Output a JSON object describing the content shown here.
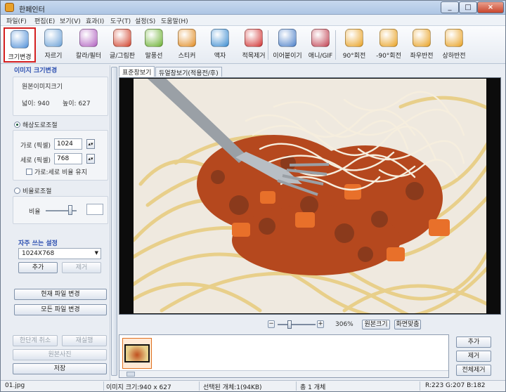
{
  "window": {
    "title": "한페인터",
    "minimize": "_",
    "maximize": "□",
    "close": "×"
  },
  "menu": [
    "파일(F)",
    "편집(E)",
    "보기(V)",
    "효과(I)",
    "도구(T)",
    "설정(S)",
    "도움말(H)"
  ],
  "toolbar": [
    {
      "label": "크기변경",
      "icon": "resize-icon",
      "color": "#4f8fd8"
    },
    {
      "label": "자르기",
      "icon": "crop-icon",
      "color": "#6aa0d6"
    },
    {
      "label": "칼라/필터",
      "icon": "color-filter-icon",
      "color": "#b060c0"
    },
    {
      "label": "글/그림판",
      "icon": "text-paint-icon",
      "color": "#d0402a"
    },
    {
      "label": "말풍선",
      "icon": "speech-bubble-icon",
      "color": "#6ab030"
    },
    {
      "label": "스티커",
      "icon": "sticker-icon",
      "color": "#e08a20"
    },
    {
      "label": "액자",
      "icon": "frame-icon",
      "color": "#3a8bd0"
    },
    {
      "label": "적목제거",
      "icon": "redeye-icon",
      "color": "#d03030"
    },
    {
      "label": "이어붙이기",
      "icon": "merge-icon",
      "color": "#4a7ec8"
    },
    {
      "label": "애니/GIF",
      "icon": "gif-icon",
      "color": "#c04050"
    },
    {
      "label": "90°회전",
      "icon": "rotate-right-icon",
      "color": "#e8a020"
    },
    {
      "label": "-90°회전",
      "icon": "rotate-left-icon",
      "color": "#e8a020"
    },
    {
      "label": "좌우반전",
      "icon": "flip-horizontal-icon",
      "color": "#e8a020"
    },
    {
      "label": "상하반전",
      "icon": "flip-vertical-icon",
      "color": "#e8a020"
    }
  ],
  "left": {
    "section_title": "이미지 크기변경",
    "original_label": "원본이미지크기",
    "width_text": "넓이: 940",
    "height_text": "높이: 627",
    "resolution_label": "해상도로조절",
    "w_label": "가로 (픽셀)",
    "w_value": "1024",
    "h_label": "세로 (픽셀)",
    "h_value": "768",
    "keep_ratio_label": "가로:세로 비율 유지",
    "ratio_label": "비율로조절",
    "ratio_sub": "비율",
    "ratio_value": "",
    "favorites_title": "자주 쓰는 설정",
    "favorites_value": "1024X768",
    "add": "추가",
    "remove": "제거",
    "apply_current": "현재 파일 변경",
    "apply_all": "모든 파일 변경",
    "undo": "한단계 취소",
    "redo": "재실행",
    "original_photo": "원본사진",
    "save": "저장"
  },
  "tabs": [
    "표준창보기",
    "듀얼창보기(적용전/후)"
  ],
  "zoom": {
    "percent": "306%",
    "original_size": "원본크기",
    "fit_screen": "화면맞춤",
    "minus": "−",
    "plus": "+",
    "level": 0.3
  },
  "strip_buttons": {
    "add": "추가",
    "remove": "제거",
    "remove_all": "전체제거"
  },
  "status": {
    "file": "01.jpg",
    "size": "이미지 크기:940 x 627",
    "selected": "선택된 개체:1(94KB)",
    "total": "총 1 개체",
    "rgb": "R:223 G:207 B:182"
  },
  "colors": {
    "accent_title": "#2c4fb0",
    "active_border": "#d42020"
  }
}
